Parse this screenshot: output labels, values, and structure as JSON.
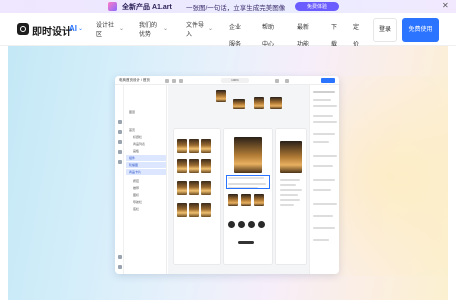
{
  "promo": {
    "brand": "全新产品 A1.art",
    "text": "一张图/一句话，立享生成完美图像",
    "button": "免费体验"
  },
  "nav": {
    "logo": "即时设计",
    "ai": "AI",
    "items": [
      {
        "label": "设计社区"
      },
      {
        "label": "我们的优势"
      },
      {
        "label": "文件导入"
      }
    ],
    "plain": [
      "企业服务",
      "帮助中心",
      "最新功能",
      "下载",
      "定价"
    ],
    "login": "登录",
    "signup": "免费使用"
  },
  "app_preview": {
    "title": "电商首页设计 / 首页",
    "zoom": "100%",
    "layers": [
      "图层",
      "首页",
      "标题栏",
      "商品列表",
      "画板",
      "组件",
      "轮播图",
      "商品卡片",
      "按钮",
      "推荐",
      "图标",
      "导航栏",
      "底栏"
    ]
  },
  "colors": {
    "accent": "#2a74ff",
    "promo_btn": "#6a5cff"
  }
}
